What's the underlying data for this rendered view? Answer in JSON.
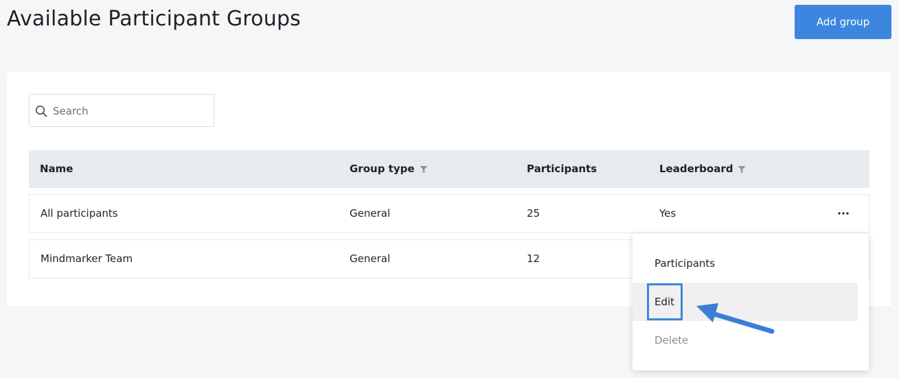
{
  "page": {
    "title": "Available Participant Groups"
  },
  "toolbar": {
    "add_group_label": "Add group"
  },
  "search": {
    "placeholder": "Search",
    "value": ""
  },
  "table": {
    "columns": [
      {
        "label": "Name",
        "filter": false
      },
      {
        "label": "Group type",
        "filter": true
      },
      {
        "label": "Participants",
        "filter": false
      },
      {
        "label": "Leaderboard",
        "filter": true
      }
    ],
    "rows": [
      {
        "name": "All participants",
        "group_type": "General",
        "participants": "25",
        "leaderboard": "Yes"
      },
      {
        "name": "Mindmarker Team",
        "group_type": "General",
        "participants": "12",
        "leaderboard": ""
      }
    ]
  },
  "row_menu": {
    "items": [
      {
        "label": "Participants",
        "state": "normal"
      },
      {
        "label": "Edit",
        "state": "highlighted"
      },
      {
        "label": "Delete",
        "state": "disabled"
      }
    ]
  },
  "icons": {
    "search": "search-icon",
    "filter": "filter-icon",
    "more": "more-horizontal-icon",
    "annotation_arrow": "arrow-icon"
  },
  "colors": {
    "accent": "#3c86e0",
    "header_bg": "#e8ebee",
    "page_bg": "#f5f6f8"
  }
}
